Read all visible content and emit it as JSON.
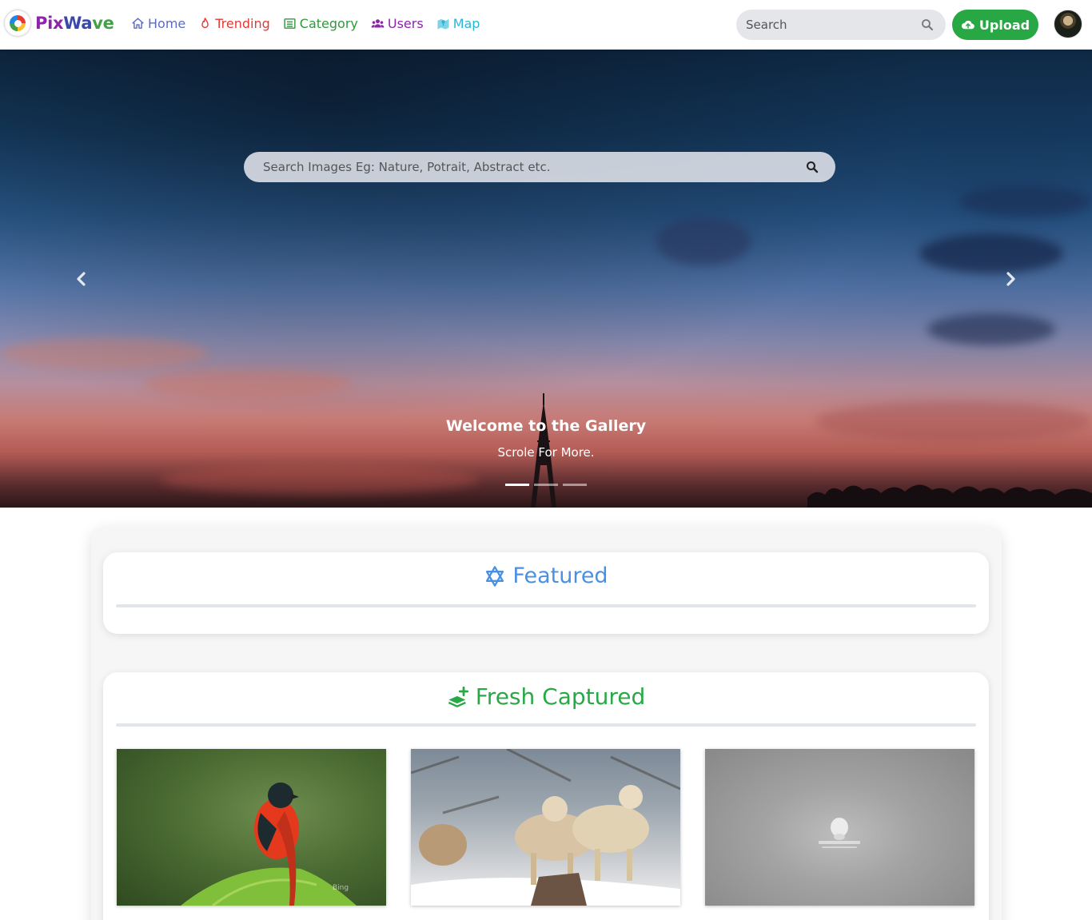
{
  "brand": {
    "name_part1": "Pix",
    "name_part2": "Wa",
    "name_part3": "ve"
  },
  "nav": {
    "items": [
      {
        "label": "Home",
        "icon": "home-icon",
        "color": "#5c6bc0"
      },
      {
        "label": "Trending",
        "icon": "fire-icon",
        "color": "#e53935"
      },
      {
        "label": "Category",
        "icon": "list-icon",
        "color": "#2e9a3a"
      },
      {
        "label": "Users",
        "icon": "users-icon",
        "color": "#8e24aa"
      },
      {
        "label": "Map",
        "icon": "map-icon",
        "color": "#29b6d6"
      }
    ],
    "search_placeholder": "Search",
    "upload_label": "Upload"
  },
  "hero": {
    "search_placeholder": "Search Images Eg: Nature, Potrait, Abstract etc.",
    "caption_title": "Welcome to the Gallery",
    "caption_subtitle": "Scrole For More.",
    "slide_count": 3,
    "active_slide": 1
  },
  "sections": {
    "featured": {
      "title": "Featured",
      "icon": "star-of-david-icon",
      "color": "#4a90e2"
    },
    "fresh": {
      "title": "Fresh Captured",
      "icon": "layer-plus-icon",
      "color": "#2aa845",
      "images": [
        {
          "subject": "bird-on-leaf",
          "watermark": "Bing"
        },
        {
          "subject": "wolves-in-snow",
          "watermark": ""
        },
        {
          "subject": "linux-wallpaper",
          "watermark": ""
        }
      ]
    }
  },
  "colors": {
    "accent_green": "#28a745",
    "accent_blue": "#4a90e2"
  }
}
